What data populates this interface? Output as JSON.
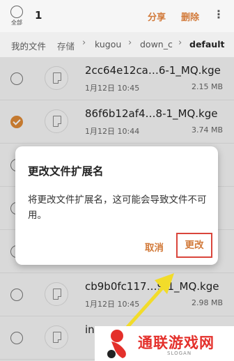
{
  "header": {
    "select_all_label": "全部",
    "selected_count": "1",
    "share_label": "分享",
    "delete_label": "删除",
    "more_label": "⋮"
  },
  "breadcrumb": {
    "items": [
      "我的文件",
      "存储",
      "kugou",
      "down_c",
      "default"
    ]
  },
  "files": [
    {
      "name": "2cc64e12ca…6-1_MQ.kge",
      "date": "1月12日 10:45",
      "size": "2.15 MB",
      "checked": false
    },
    {
      "name": "86f6b12af4…8-1_MQ.kge",
      "date": "1月12日 10:44",
      "size": "3.74 MB",
      "checked": true
    },
    {
      "name": "",
      "date": "",
      "size": "",
      "checked": false
    },
    {
      "name": "",
      "date": "",
      "size": "",
      "checked": false
    },
    {
      "name": "",
      "date": "",
      "size": "",
      "checked": false
    },
    {
      "name": "cb9b0fc117…9-1_MQ.kge",
      "date": "1月12日 10:45",
      "size": "2.98 MB",
      "checked": false
    },
    {
      "name": "in",
      "date": "",
      "size": "",
      "checked": false
    }
  ],
  "dialog": {
    "title": "更改文件扩展名",
    "message": "将更改文件扩展名，这可能会导致文件不可用。",
    "cancel_label": "取消",
    "confirm_label": "更改"
  },
  "watermark": {
    "title": "通联游戏网",
    "slogan": "SLOGAN"
  },
  "colors": {
    "accent": "#e08a36",
    "highlight_box": "#d9453b",
    "watermark_red": "#e4302b",
    "arrow_yellow": "#f2dc2a"
  },
  "icons": {
    "file": "document-icon",
    "checkmark": "check-icon",
    "more": "more-vertical-icon"
  }
}
